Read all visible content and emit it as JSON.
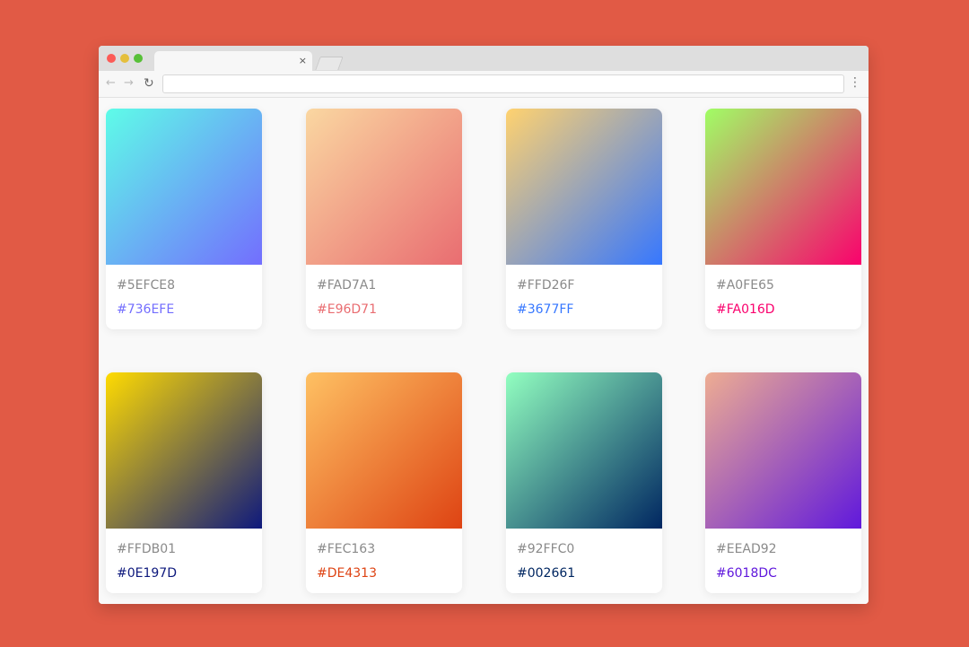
{
  "browser": {
    "tab_close": "×",
    "nav_back": "←",
    "nav_forward": "→",
    "nav_reload": "↻",
    "menu": "⋮"
  },
  "gradients": [
    {
      "from": "#5EFCE8",
      "to": "#736EFE"
    },
    {
      "from": "#FAD7A1",
      "to": "#E96D71"
    },
    {
      "from": "#FFD26F",
      "to": "#3677FF"
    },
    {
      "from": "#A0FE65",
      "to": "#FA016D"
    },
    {
      "from": "#FFDB01",
      "to": "#0E197D"
    },
    {
      "from": "#FEC163",
      "to": "#DE4313"
    },
    {
      "from": "#92FFC0",
      "to": "#002661"
    },
    {
      "from": "#EEAD92",
      "to": "#6018DC"
    }
  ]
}
